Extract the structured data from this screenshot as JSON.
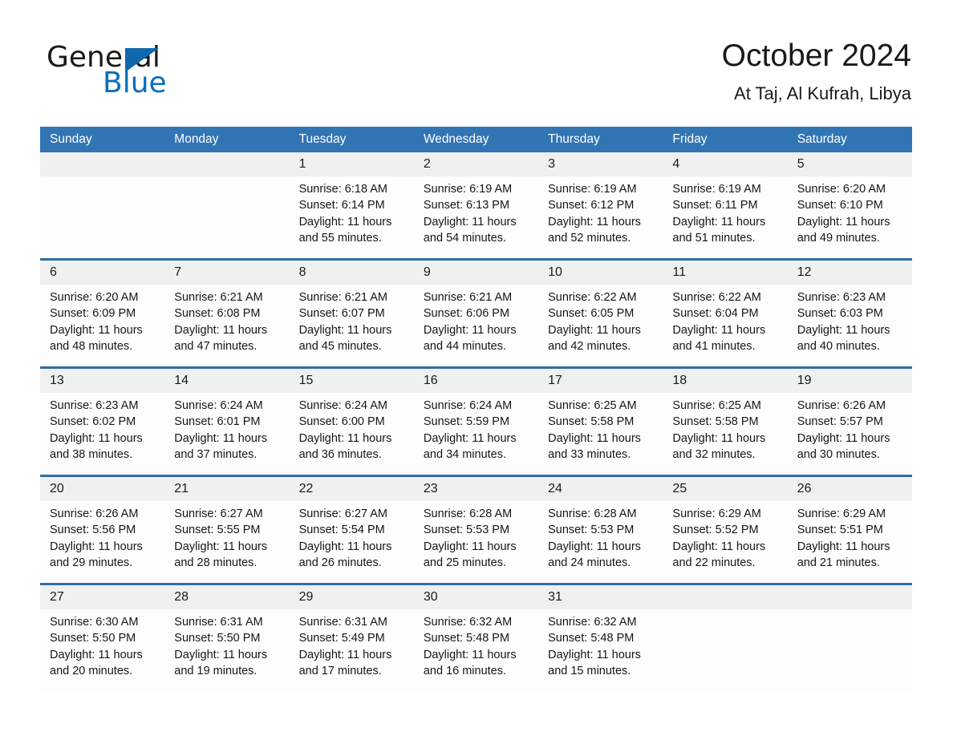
{
  "brand": {
    "name_part1": "General",
    "name_part2": "Blue",
    "triangle_color": "#1268ad",
    "blue_text_color": "#0b6fba"
  },
  "header": {
    "title": "October 2024",
    "location": "At Taj, Al Kufrah, Libya"
  },
  "theme": {
    "header_band": "#3275b4",
    "row_divider": "#2e6da4",
    "date_band": "#f0f0f0",
    "cell_bg": "#fdfdfd"
  },
  "weekdays": [
    "Sunday",
    "Monday",
    "Tuesday",
    "Wednesday",
    "Thursday",
    "Friday",
    "Saturday"
  ],
  "weeks": [
    [
      {
        "empty": true
      },
      {
        "empty": true
      },
      {
        "day": "1",
        "sunrise": "Sunrise: 6:18 AM",
        "sunset": "Sunset: 6:14 PM",
        "daylight_line1": "Daylight: 11 hours",
        "daylight_line2": "and 55 minutes."
      },
      {
        "day": "2",
        "sunrise": "Sunrise: 6:19 AM",
        "sunset": "Sunset: 6:13 PM",
        "daylight_line1": "Daylight: 11 hours",
        "daylight_line2": "and 54 minutes."
      },
      {
        "day": "3",
        "sunrise": "Sunrise: 6:19 AM",
        "sunset": "Sunset: 6:12 PM",
        "daylight_line1": "Daylight: 11 hours",
        "daylight_line2": "and 52 minutes."
      },
      {
        "day": "4",
        "sunrise": "Sunrise: 6:19 AM",
        "sunset": "Sunset: 6:11 PM",
        "daylight_line1": "Daylight: 11 hours",
        "daylight_line2": "and 51 minutes."
      },
      {
        "day": "5",
        "sunrise": "Sunrise: 6:20 AM",
        "sunset": "Sunset: 6:10 PM",
        "daylight_line1": "Daylight: 11 hours",
        "daylight_line2": "and 49 minutes."
      }
    ],
    [
      {
        "day": "6",
        "sunrise": "Sunrise: 6:20 AM",
        "sunset": "Sunset: 6:09 PM",
        "daylight_line1": "Daylight: 11 hours",
        "daylight_line2": "and 48 minutes."
      },
      {
        "day": "7",
        "sunrise": "Sunrise: 6:21 AM",
        "sunset": "Sunset: 6:08 PM",
        "daylight_line1": "Daylight: 11 hours",
        "daylight_line2": "and 47 minutes."
      },
      {
        "day": "8",
        "sunrise": "Sunrise: 6:21 AM",
        "sunset": "Sunset: 6:07 PM",
        "daylight_line1": "Daylight: 11 hours",
        "daylight_line2": "and 45 minutes."
      },
      {
        "day": "9",
        "sunrise": "Sunrise: 6:21 AM",
        "sunset": "Sunset: 6:06 PM",
        "daylight_line1": "Daylight: 11 hours",
        "daylight_line2": "and 44 minutes."
      },
      {
        "day": "10",
        "sunrise": "Sunrise: 6:22 AM",
        "sunset": "Sunset: 6:05 PM",
        "daylight_line1": "Daylight: 11 hours",
        "daylight_line2": "and 42 minutes."
      },
      {
        "day": "11",
        "sunrise": "Sunrise: 6:22 AM",
        "sunset": "Sunset: 6:04 PM",
        "daylight_line1": "Daylight: 11 hours",
        "daylight_line2": "and 41 minutes."
      },
      {
        "day": "12",
        "sunrise": "Sunrise: 6:23 AM",
        "sunset": "Sunset: 6:03 PM",
        "daylight_line1": "Daylight: 11 hours",
        "daylight_line2": "and 40 minutes."
      }
    ],
    [
      {
        "day": "13",
        "sunrise": "Sunrise: 6:23 AM",
        "sunset": "Sunset: 6:02 PM",
        "daylight_line1": "Daylight: 11 hours",
        "daylight_line2": "and 38 minutes."
      },
      {
        "day": "14",
        "sunrise": "Sunrise: 6:24 AM",
        "sunset": "Sunset: 6:01 PM",
        "daylight_line1": "Daylight: 11 hours",
        "daylight_line2": "and 37 minutes."
      },
      {
        "day": "15",
        "sunrise": "Sunrise: 6:24 AM",
        "sunset": "Sunset: 6:00 PM",
        "daylight_line1": "Daylight: 11 hours",
        "daylight_line2": "and 36 minutes."
      },
      {
        "day": "16",
        "sunrise": "Sunrise: 6:24 AM",
        "sunset": "Sunset: 5:59 PM",
        "daylight_line1": "Daylight: 11 hours",
        "daylight_line2": "and 34 minutes."
      },
      {
        "day": "17",
        "sunrise": "Sunrise: 6:25 AM",
        "sunset": "Sunset: 5:58 PM",
        "daylight_line1": "Daylight: 11 hours",
        "daylight_line2": "and 33 minutes."
      },
      {
        "day": "18",
        "sunrise": "Sunrise: 6:25 AM",
        "sunset": "Sunset: 5:58 PM",
        "daylight_line1": "Daylight: 11 hours",
        "daylight_line2": "and 32 minutes."
      },
      {
        "day": "19",
        "sunrise": "Sunrise: 6:26 AM",
        "sunset": "Sunset: 5:57 PM",
        "daylight_line1": "Daylight: 11 hours",
        "daylight_line2": "and 30 minutes."
      }
    ],
    [
      {
        "day": "20",
        "sunrise": "Sunrise: 6:26 AM",
        "sunset": "Sunset: 5:56 PM",
        "daylight_line1": "Daylight: 11 hours",
        "daylight_line2": "and 29 minutes."
      },
      {
        "day": "21",
        "sunrise": "Sunrise: 6:27 AM",
        "sunset": "Sunset: 5:55 PM",
        "daylight_line1": "Daylight: 11 hours",
        "daylight_line2": "and 28 minutes."
      },
      {
        "day": "22",
        "sunrise": "Sunrise: 6:27 AM",
        "sunset": "Sunset: 5:54 PM",
        "daylight_line1": "Daylight: 11 hours",
        "daylight_line2": "and 26 minutes."
      },
      {
        "day": "23",
        "sunrise": "Sunrise: 6:28 AM",
        "sunset": "Sunset: 5:53 PM",
        "daylight_line1": "Daylight: 11 hours",
        "daylight_line2": "and 25 minutes."
      },
      {
        "day": "24",
        "sunrise": "Sunrise: 6:28 AM",
        "sunset": "Sunset: 5:53 PM",
        "daylight_line1": "Daylight: 11 hours",
        "daylight_line2": "and 24 minutes."
      },
      {
        "day": "25",
        "sunrise": "Sunrise: 6:29 AM",
        "sunset": "Sunset: 5:52 PM",
        "daylight_line1": "Daylight: 11 hours",
        "daylight_line2": "and 22 minutes."
      },
      {
        "day": "26",
        "sunrise": "Sunrise: 6:29 AM",
        "sunset": "Sunset: 5:51 PM",
        "daylight_line1": "Daylight: 11 hours",
        "daylight_line2": "and 21 minutes."
      }
    ],
    [
      {
        "day": "27",
        "sunrise": "Sunrise: 6:30 AM",
        "sunset": "Sunset: 5:50 PM",
        "daylight_line1": "Daylight: 11 hours",
        "daylight_line2": "and 20 minutes."
      },
      {
        "day": "28",
        "sunrise": "Sunrise: 6:31 AM",
        "sunset": "Sunset: 5:50 PM",
        "daylight_line1": "Daylight: 11 hours",
        "daylight_line2": "and 19 minutes."
      },
      {
        "day": "29",
        "sunrise": "Sunrise: 6:31 AM",
        "sunset": "Sunset: 5:49 PM",
        "daylight_line1": "Daylight: 11 hours",
        "daylight_line2": "and 17 minutes."
      },
      {
        "day": "30",
        "sunrise": "Sunrise: 6:32 AM",
        "sunset": "Sunset: 5:48 PM",
        "daylight_line1": "Daylight: 11 hours",
        "daylight_line2": "and 16 minutes."
      },
      {
        "day": "31",
        "sunrise": "Sunrise: 6:32 AM",
        "sunset": "Sunset: 5:48 PM",
        "daylight_line1": "Daylight: 11 hours",
        "daylight_line2": "and 15 minutes."
      },
      {
        "empty": true
      },
      {
        "empty": true
      }
    ]
  ]
}
